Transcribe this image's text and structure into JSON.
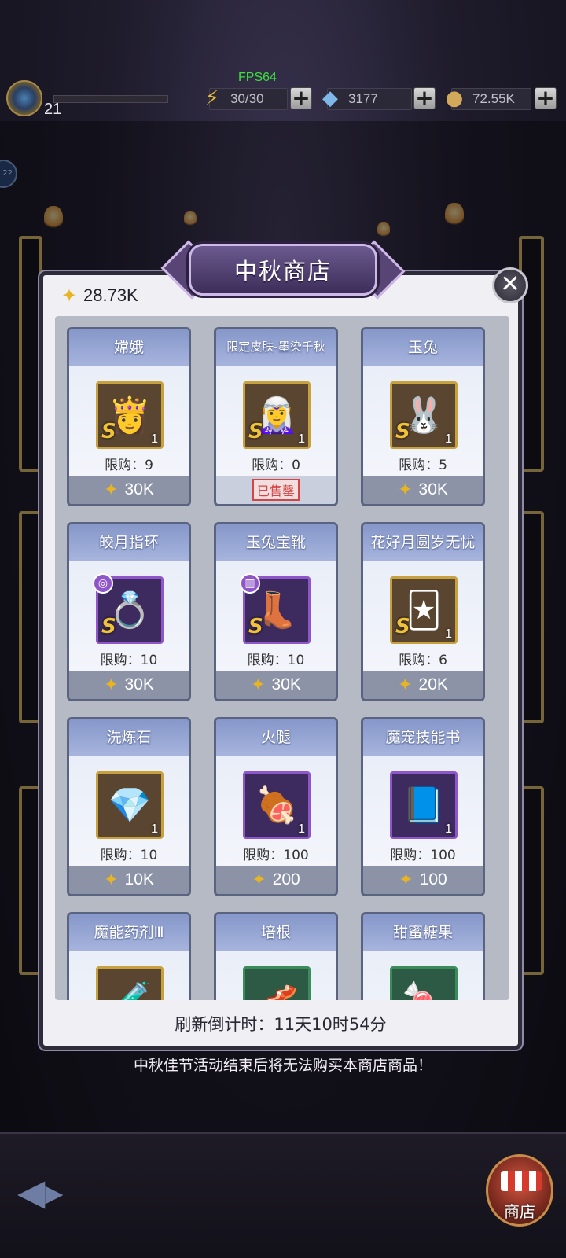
{
  "hud": {
    "fps": "FPS64",
    "level": "21",
    "stamina": "30/30",
    "gems": "3177",
    "coins": "72.55K"
  },
  "side_badge": "22",
  "shop": {
    "title": "中秋商店",
    "currency": "28.73K",
    "refresh_label": "刷新倒计时：11天10时54分",
    "notice": "中秋佳节活动结束后将无法购买本商店商品！",
    "items": [
      {
        "name": "嫦娥",
        "limit": "限购：9",
        "price": "30K",
        "qty": "1",
        "grade": "S"
      },
      {
        "name": "限定皮肤-墨染千秋",
        "limit": "限购：0",
        "price": "",
        "sold_out": "已售罄",
        "qty": "1",
        "grade": "S"
      },
      {
        "name": "玉兔",
        "limit": "限购：5",
        "price": "30K",
        "qty": "1",
        "grade": "S"
      },
      {
        "name": "皎月指环",
        "limit": "限购：10",
        "price": "30K",
        "grade": "S"
      },
      {
        "name": "玉兔宝靴",
        "limit": "限购：10",
        "price": "30K",
        "grade": "S"
      },
      {
        "name": "花好月圆岁无忧",
        "limit": "限购：6",
        "price": "20K",
        "qty": "1",
        "grade": "S"
      },
      {
        "name": "洗炼石",
        "limit": "限购：10",
        "price": "10K",
        "qty": "1"
      },
      {
        "name": "火腿",
        "limit": "限购：100",
        "price": "200",
        "qty": "1"
      },
      {
        "name": "魔宠技能书",
        "limit": "限购：100",
        "price": "100",
        "qty": "1"
      },
      {
        "name": "魔能药剂Ⅲ"
      },
      {
        "name": "培根"
      },
      {
        "name": "甜蜜糖果"
      }
    ]
  },
  "bottom": {
    "shop_label": "商店"
  },
  "icons": {
    "currency": "mooncake-lantern-icon",
    "close": "close-icon",
    "back": "back-arrow-icon"
  }
}
